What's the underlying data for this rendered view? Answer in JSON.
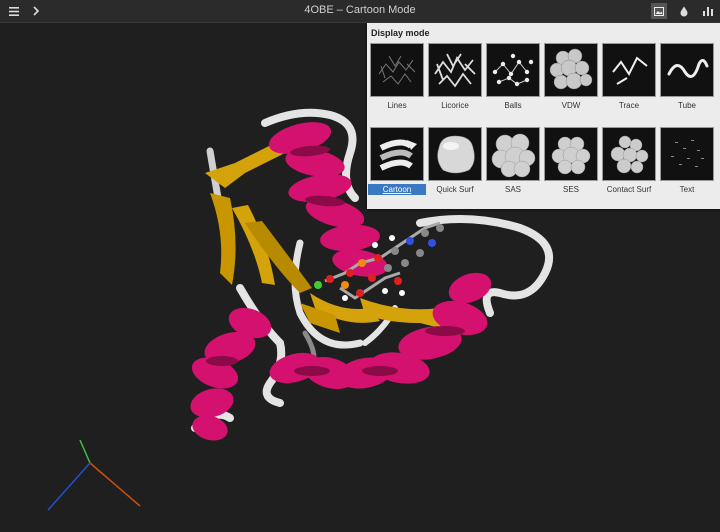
{
  "topbar": {
    "title": "4OBE – Cartoon Mode",
    "icons": [
      "menu-icon",
      "chevron-right-icon",
      "image-icon",
      "droplet-icon",
      "bar-chart-icon"
    ]
  },
  "panel": {
    "title": "Display mode",
    "modes": [
      {
        "label": "Lines",
        "selected": false
      },
      {
        "label": "Licorice",
        "selected": false
      },
      {
        "label": "Balls",
        "selected": false
      },
      {
        "label": "VDW",
        "selected": false
      },
      {
        "label": "Trace",
        "selected": false
      },
      {
        "label": "Tube",
        "selected": false
      },
      {
        "label": "Cartoon",
        "selected": true
      },
      {
        "label": "Quick Surf",
        "selected": false
      },
      {
        "label": "SAS",
        "selected": false
      },
      {
        "label": "SES",
        "selected": false
      },
      {
        "label": "Contact Surf",
        "selected": false
      },
      {
        "label": "Text",
        "selected": false
      }
    ]
  },
  "colors": {
    "background": "#1f1f1f",
    "helix": "#d4116e",
    "sheet": "#d4a20a",
    "coil": "#e0e0e0",
    "selected": "#3a78c2"
  }
}
